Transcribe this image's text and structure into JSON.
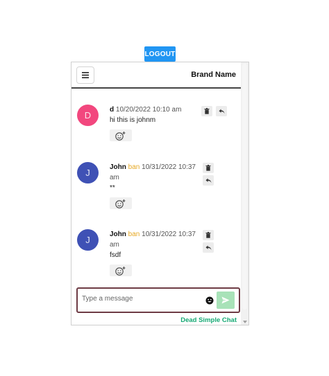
{
  "header": {
    "logout_label": "LOGOUT",
    "brand_name": "Brand Name"
  },
  "messages": [
    {
      "avatar_letter": "D",
      "avatar_color": "#f2477e",
      "author": "d",
      "ban_label": "",
      "timestamp": "10/20/2022 10:10 am",
      "text": "hi this is johnm"
    },
    {
      "avatar_letter": "J",
      "avatar_color": "#3f51b5",
      "author": "John",
      "ban_label": "ban",
      "timestamp": "10/31/2022 10:37 am",
      "text": "**"
    },
    {
      "avatar_letter": "J",
      "avatar_color": "#3f51b5",
      "author": "John",
      "ban_label": "ban",
      "timestamp": "10/31/2022 10:37 am",
      "text": "fsdf"
    }
  ],
  "composer": {
    "placeholder": "Type a message"
  },
  "footer": {
    "powered_by": "Dead Simple Chat"
  },
  "colors": {
    "logout": "#2196f3",
    "send_button": "#a8e2b8",
    "composer_border": "#6d3b44",
    "ban": "#e6a823",
    "powered_by": "#16a974"
  },
  "icons": {
    "menu": "hamburger-icon",
    "delete": "trash-icon",
    "reply": "reply-icon",
    "reaction": "add-reaction-icon",
    "emoji": "emoji-icon",
    "send": "send-icon"
  }
}
